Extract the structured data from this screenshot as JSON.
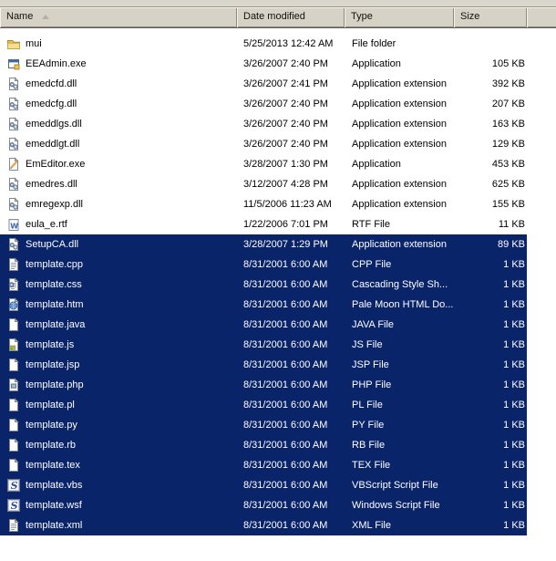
{
  "header": {
    "columns": [
      {
        "label": "Name",
        "sorted": "ascending"
      },
      {
        "label": "Date modified"
      },
      {
        "label": "Type"
      },
      {
        "label": "Size"
      }
    ]
  },
  "colors": {
    "selection_background": "#0A246A",
    "selected_text": "#FFFFFF",
    "header_face": "#D6D2C5"
  },
  "files": [
    {
      "name": "mui",
      "date": "5/25/2013 12:42 AM",
      "type": "File folder",
      "size": "",
      "icon": "folder-icon",
      "selected": false
    },
    {
      "name": "EEAdmin.exe",
      "date": "3/26/2007 2:40 PM",
      "type": "Application",
      "size": "105 KB",
      "icon": "application-icon",
      "selected": false
    },
    {
      "name": "emedcfd.dll",
      "date": "3/26/2007 2:41 PM",
      "type": "Application extension",
      "size": "392 KB",
      "icon": "dll-icon",
      "selected": false
    },
    {
      "name": "emedcfg.dll",
      "date": "3/26/2007 2:40 PM",
      "type": "Application extension",
      "size": "207 KB",
      "icon": "dll-icon",
      "selected": false
    },
    {
      "name": "emeddlgs.dll",
      "date": "3/26/2007 2:40 PM",
      "type": "Application extension",
      "size": "163 KB",
      "icon": "dll-icon",
      "selected": false
    },
    {
      "name": "emeddlgt.dll",
      "date": "3/26/2007 2:40 PM",
      "type": "Application extension",
      "size": "129 KB",
      "icon": "dll-icon",
      "selected": false
    },
    {
      "name": "EmEditor.exe",
      "date": "3/28/2007 1:30 PM",
      "type": "Application",
      "size": "453 KB",
      "icon": "emeditor-icon",
      "selected": false
    },
    {
      "name": "emedres.dll",
      "date": "3/12/2007 4:28 PM",
      "type": "Application extension",
      "size": "625 KB",
      "icon": "dll-icon",
      "selected": false
    },
    {
      "name": "emregexp.dll",
      "date": "11/5/2006 11:23 AM",
      "type": "Application extension",
      "size": "155 KB",
      "icon": "dll-icon",
      "selected": false
    },
    {
      "name": "eula_e.rtf",
      "date": "1/22/2006 7:01 PM",
      "type": "RTF File",
      "size": "11 KB",
      "icon": "rtf-icon",
      "selected": false
    },
    {
      "name": "SetupCA.dll",
      "date": "3/28/2007 1:29 PM",
      "type": "Application extension",
      "size": "89 KB",
      "icon": "dll-icon",
      "selected": true
    },
    {
      "name": "template.cpp",
      "date": "8/31/2001 6:00 AM",
      "type": "CPP File",
      "size": "1 KB",
      "icon": "text-file-icon",
      "selected": true
    },
    {
      "name": "template.css",
      "date": "8/31/2001 6:00 AM",
      "type": "Cascading Style Sh...",
      "size": "1 KB",
      "icon": "css-icon",
      "selected": true
    },
    {
      "name": "template.htm",
      "date": "8/31/2001 6:00 AM",
      "type": "Pale Moon HTML Do...",
      "size": "1 KB",
      "icon": "html-icon",
      "selected": true
    },
    {
      "name": "template.java",
      "date": "8/31/2001 6:00 AM",
      "type": "JAVA File",
      "size": "1 KB",
      "icon": "file-icon",
      "selected": true
    },
    {
      "name": "template.js",
      "date": "8/31/2001 6:00 AM",
      "type": "JS File",
      "size": "1 KB",
      "icon": "js-icon",
      "selected": true
    },
    {
      "name": "template.jsp",
      "date": "8/31/2001 6:00 AM",
      "type": "JSP File",
      "size": "1 KB",
      "icon": "file-icon",
      "selected": true
    },
    {
      "name": "template.php",
      "date": "8/31/2001 6:00 AM",
      "type": "PHP File",
      "size": "1 KB",
      "icon": "php-icon",
      "selected": true
    },
    {
      "name": "template.pl",
      "date": "8/31/2001 6:00 AM",
      "type": "PL File",
      "size": "1 KB",
      "icon": "file-icon",
      "selected": true
    },
    {
      "name": "template.py",
      "date": "8/31/2001 6:00 AM",
      "type": "PY File",
      "size": "1 KB",
      "icon": "file-icon",
      "selected": true
    },
    {
      "name": "template.rb",
      "date": "8/31/2001 6:00 AM",
      "type": "RB File",
      "size": "1 KB",
      "icon": "file-icon",
      "selected": true
    },
    {
      "name": "template.tex",
      "date": "8/31/2001 6:00 AM",
      "type": "TEX File",
      "size": "1 KB",
      "icon": "file-icon",
      "selected": true
    },
    {
      "name": "template.vbs",
      "date": "8/31/2001 6:00 AM",
      "type": "VBScript Script File",
      "size": "1 KB",
      "icon": "vbscript-icon",
      "selected": true
    },
    {
      "name": "template.wsf",
      "date": "8/31/2001 6:00 AM",
      "type": "Windows Script File",
      "size": "1 KB",
      "icon": "windows-script-icon",
      "selected": true
    },
    {
      "name": "template.xml",
      "date": "8/31/2001 6:00 AM",
      "type": "XML File",
      "size": "1 KB",
      "icon": "xml-icon",
      "selected": true
    }
  ]
}
